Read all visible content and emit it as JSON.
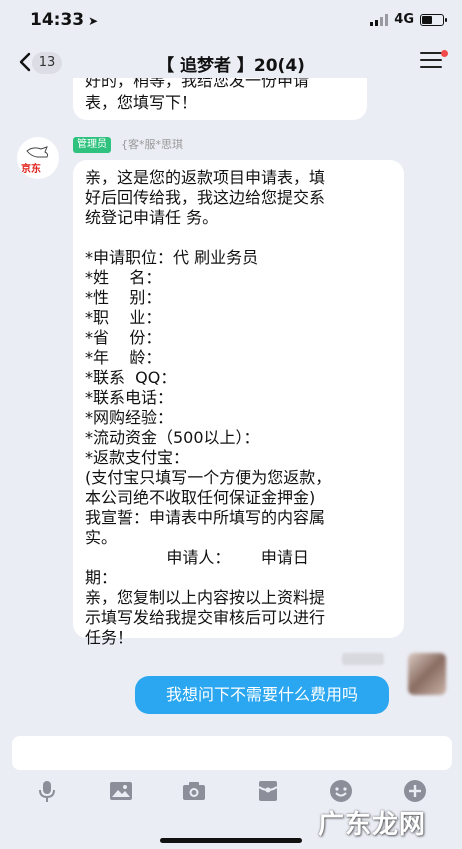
{
  "status": {
    "time": "14:33",
    "network": "4G"
  },
  "nav": {
    "unread": "13",
    "title": "【 追梦者 】20(4)"
  },
  "top_bubble": {
    "line1": "好的，稍等，我给您发一份申请",
    "line2": "表，您填写下！"
  },
  "sender": {
    "role": "管理员",
    "name": "{客*服*思琪",
    "avatar_text": "京东"
  },
  "main_bubble": {
    "lines": [
      "亲，这是您的返款项目申请表，填",
      "好后回传给我，我这边给您提交系",
      "统登记申请任 务。",
      "",
      "*申请职位：代 刷业务员",
      "*姓    名：",
      "*性    别：",
      "*职    业：",
      "*省    份：",
      "*年    龄：",
      "*联系  QQ：",
      "*联系电话：",
      "*网购经验：",
      "*流动资金（500以上）：",
      "*返款支付宝：",
      "(支付宝只填写一个方便为您返款，",
      "本公司绝不收取任何保证金押金)",
      "我宣誓：申请表中所填写的内容属",
      "实。",
      "                申请人：      申请日",
      "期：",
      "亲，您复制以上内容按以上资料提",
      "示填写发给我提交审核后可以进行",
      "任务！"
    ]
  },
  "outgoing": {
    "text": "我想问下不需要什么费用吗"
  },
  "input": {
    "placeholder": ""
  },
  "toolbar": {
    "icons": [
      "mic-icon",
      "image-icon",
      "camera-icon",
      "red-packet-icon",
      "emoji-icon",
      "plus-icon"
    ]
  },
  "watermark": {
    "text": "广东龙网"
  },
  "colors": {
    "background": "#ebedf5",
    "outgoing_bubble": "#2aa7f0",
    "role_badge": "#2ec27e"
  }
}
